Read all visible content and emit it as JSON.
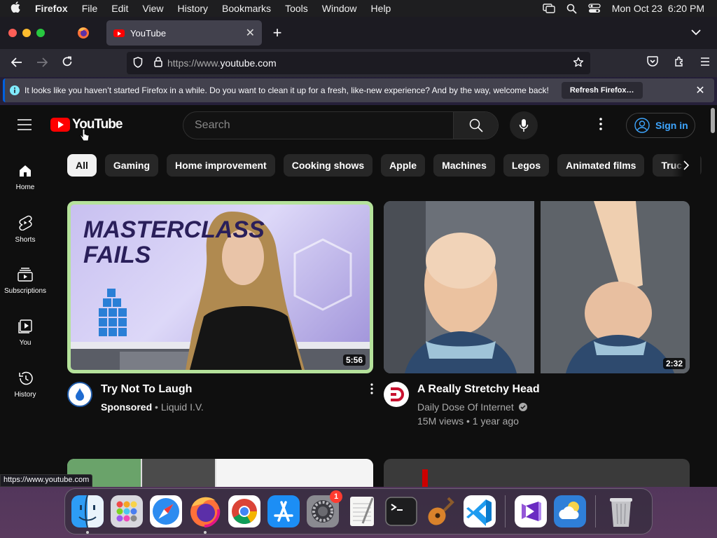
{
  "menubar": {
    "app_name": "Firefox",
    "items": [
      "File",
      "Edit",
      "View",
      "History",
      "Bookmarks",
      "Tools",
      "Window",
      "Help"
    ],
    "clock": "Mon Oct 23  6:20 PM"
  },
  "browser": {
    "tab_title": "YouTube",
    "url_prefix": "https://www.",
    "url_domain": "youtube.com",
    "notification": {
      "message": "It looks like you haven’t started Firefox in a while. Do you want to clean it up for a fresh, like-new experience? And by the way, welcome back!",
      "button": "Refresh Firefox…"
    },
    "status_url": "https://www.youtube.com"
  },
  "youtube": {
    "logo_text": "YouTube",
    "search_placeholder": "Search",
    "sign_in": "Sign in",
    "chips": [
      "All",
      "Gaming",
      "Home improvement",
      "Cooking shows",
      "Apple",
      "Machines",
      "Legos",
      "Animated films",
      "Trucks"
    ],
    "sidebar": [
      {
        "label": "Home",
        "icon": "home-icon"
      },
      {
        "label": "Shorts",
        "icon": "shorts-icon"
      },
      {
        "label": "Subscriptions",
        "icon": "subscriptions-icon"
      },
      {
        "label": "You",
        "icon": "you-icon"
      },
      {
        "label": "History",
        "icon": "history-icon"
      }
    ],
    "videos": [
      {
        "title": "Try Not To Laugh",
        "badge": "Sponsored",
        "channel": "Liquid I.V.",
        "duration": "5:56",
        "thumb_text_1": "MASTERCLASS",
        "thumb_text_2": "FAILS"
      },
      {
        "title": "A Really Stretchy Head",
        "channel": "Daily Dose Of Internet",
        "stats": "15M views • 1 year ago",
        "duration": "2:32"
      }
    ]
  },
  "dock": {
    "apps": [
      "Finder",
      "Launchpad",
      "Safari",
      "Firefox",
      "Chrome",
      "App Store",
      "System Settings",
      "TextEdit",
      "Terminal",
      "Instruments",
      "Visual Studio Code",
      "Visual Studio",
      "Weather",
      "Trash"
    ],
    "settings_badge": "1"
  },
  "colors": {
    "yt_red": "#ff0000",
    "link_blue": "#3ea6ff",
    "page_bg": "#0f0f0f"
  }
}
